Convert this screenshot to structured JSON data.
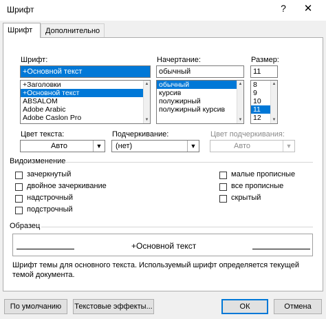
{
  "window": {
    "title": "Шрифт",
    "help_glyph": "?",
    "close_glyph": "✕"
  },
  "tabs": [
    {
      "label": "Шрифт",
      "active": true
    },
    {
      "label": "Дополнительно",
      "active": false
    }
  ],
  "font": {
    "label": "Шрифт:",
    "value": "+Основной текст",
    "items": [
      "+Заголовки",
      "+Основной текст",
      "ABSALOM",
      "Adobe Arabic",
      "Adobe Caslon Pro"
    ],
    "selected_index": 1
  },
  "style": {
    "label": "Начертание:",
    "value": "обычный",
    "items": [
      "обычный",
      "курсив",
      "полужирный",
      "полужирный курсив"
    ],
    "selected_index": 0
  },
  "size": {
    "label": "Размер:",
    "value": "11",
    "items": [
      "8",
      "9",
      "10",
      "11",
      "12"
    ],
    "selected_index": 3
  },
  "text_color": {
    "label": "Цвет текста:",
    "value": "Авто"
  },
  "underline": {
    "label": "Подчеркивание:",
    "value": "(нет)"
  },
  "underline_color": {
    "label": "Цвет подчеркивания:",
    "value": "Авто"
  },
  "effects": {
    "label": "Видоизменение",
    "left": [
      "зачеркнутый",
      "двойное зачеркивание",
      "надстрочный",
      "подстрочный"
    ],
    "right": [
      "малые прописные",
      "все прописные",
      "скрытый"
    ]
  },
  "preview": {
    "label": "Образец",
    "text": "+Основной текст"
  },
  "note": "Шрифт темы для основного текста. Используемый шрифт определяется текущей темой документа.",
  "buttons": {
    "default": "По умолчанию",
    "effects": "Текстовые эффекты...",
    "ok": "ОК",
    "cancel": "Отмена"
  },
  "colors": {
    "accent": "#0078d7",
    "panel": "#ffffff",
    "background": "#f0f0f0"
  }
}
